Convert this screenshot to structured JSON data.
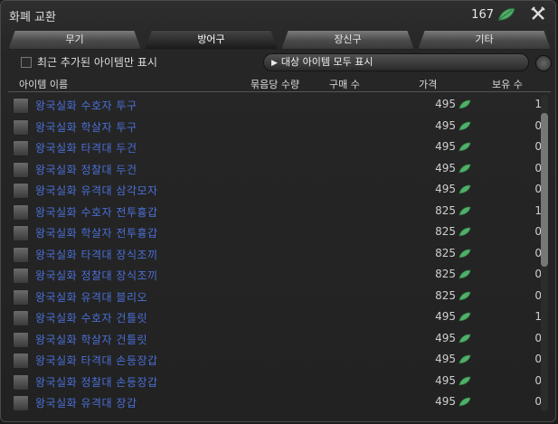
{
  "window": {
    "title": "화폐 교환",
    "currency_amount": "167",
    "currency_icon": "leaf-token-icon",
    "close_icon": "crossed-tools-icon"
  },
  "tabs": [
    {
      "label": "무기",
      "active": false
    },
    {
      "label": "방어구",
      "active": true
    },
    {
      "label": "장신구",
      "active": false
    },
    {
      "label": "기타",
      "active": false
    }
  ],
  "filter": {
    "checkbox_label": "최근 추가된 아이템만 표시",
    "checked": false,
    "show_all_label": "대상 아이템 모두 표시"
  },
  "columns": {
    "name": "아이템 이름",
    "per_bundle": "묶음당 수량",
    "buy_qty": "구매 수",
    "price": "가격",
    "owned": "보유 수"
  },
  "items": [
    {
      "name": "왕국실화 수호자 투구",
      "price": "495",
      "owned": "1",
      "icon": "helmet-icon"
    },
    {
      "name": "왕국실화 학살자 투구",
      "price": "495",
      "owned": "0",
      "icon": "helmet-icon"
    },
    {
      "name": "왕국실화 타격대 두건",
      "price": "495",
      "owned": "0",
      "icon": "helmet-icon"
    },
    {
      "name": "왕국실화 정찰대 두건",
      "price": "495",
      "owned": "0",
      "icon": "helmet-icon"
    },
    {
      "name": "왕국실화 유격대 삼각모자",
      "price": "495",
      "owned": "0",
      "icon": "helmet-icon"
    },
    {
      "name": "왕국실화 수호자 전투흉갑",
      "price": "825",
      "owned": "1",
      "icon": "body-armor-icon"
    },
    {
      "name": "왕국실화 학살자 전투흉갑",
      "price": "825",
      "owned": "0",
      "icon": "body-armor-icon"
    },
    {
      "name": "왕국실화 타격대 장식조끼",
      "price": "825",
      "owned": "0",
      "icon": "body-armor-icon"
    },
    {
      "name": "왕국실화 정찰대 장식조끼",
      "price": "825",
      "owned": "0",
      "icon": "body-armor-icon"
    },
    {
      "name": "왕국실화 유격대 블리오",
      "price": "825",
      "owned": "0",
      "icon": "body-armor-icon"
    },
    {
      "name": "왕국실화 수호자 건틀릿",
      "price": "495",
      "owned": "1",
      "icon": "gauntlet-icon"
    },
    {
      "name": "왕국실화 학살자 건틀릿",
      "price": "495",
      "owned": "0",
      "icon": "gauntlet-icon"
    },
    {
      "name": "왕국실화 타격대 손등장갑",
      "price": "495",
      "owned": "0",
      "icon": "gauntlet-icon"
    },
    {
      "name": "왕국실화 정찰대 손등장갑",
      "price": "495",
      "owned": "0",
      "icon": "gauntlet-icon"
    },
    {
      "name": "왕국실화 유격대 장갑",
      "price": "495",
      "owned": "0",
      "icon": "gauntlet-icon"
    }
  ],
  "colors": {
    "item_name": "#4a6fd6",
    "leaf": "#4fb06a"
  }
}
